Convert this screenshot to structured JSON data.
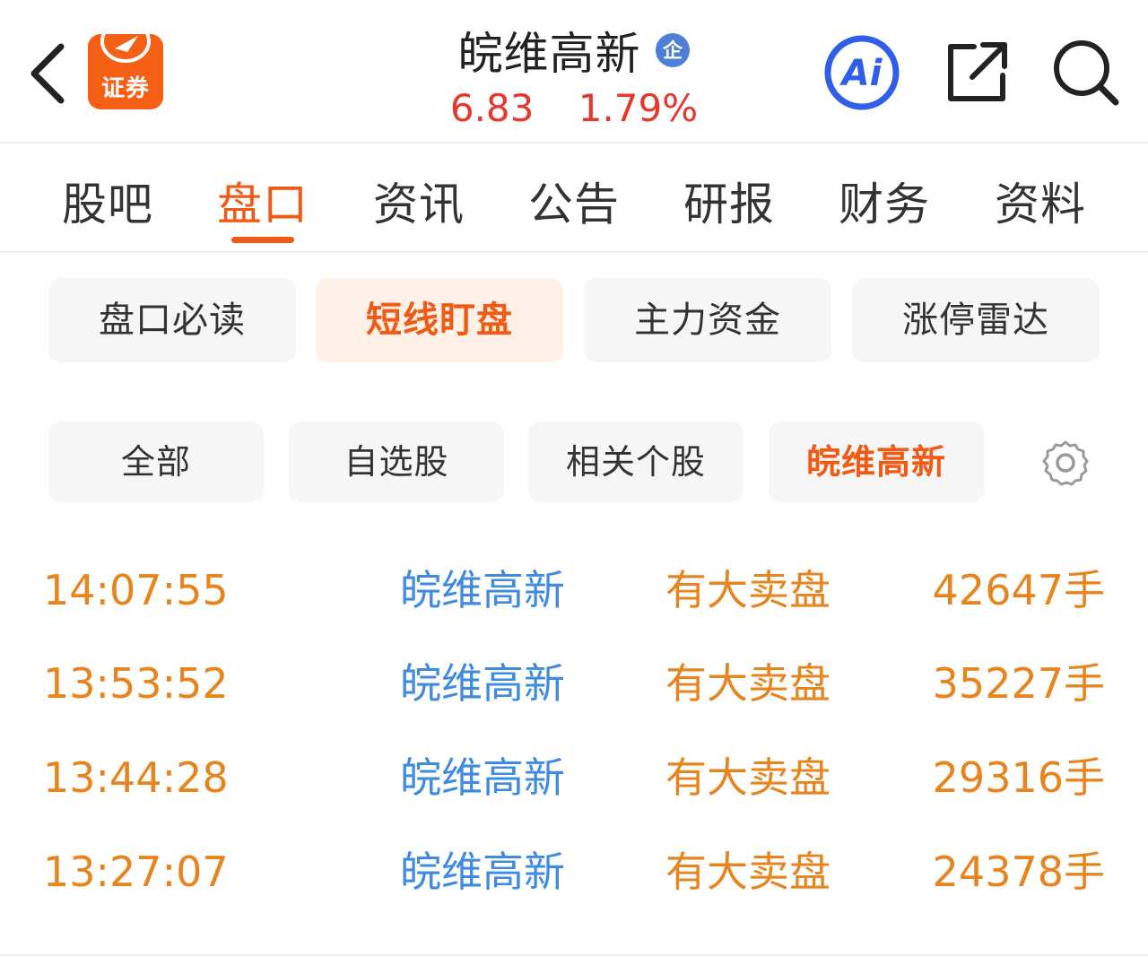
{
  "header": {
    "app_logo_text": "证券",
    "stock_name": "皖维高新",
    "badge_text": "企",
    "price": "6.83",
    "change_pct": "1.79%",
    "ai_label": "Ai"
  },
  "main_tabs": [
    {
      "label": "股吧",
      "active": false
    },
    {
      "label": "盘口",
      "active": true
    },
    {
      "label": "资讯",
      "active": false
    },
    {
      "label": "公告",
      "active": false
    },
    {
      "label": "研报",
      "active": false
    },
    {
      "label": "财务",
      "active": false
    },
    {
      "label": "资料",
      "active": false
    }
  ],
  "sub_tabs": [
    {
      "label": "盘口必读",
      "active": false
    },
    {
      "label": "短线盯盘",
      "active": true
    },
    {
      "label": "主力资金",
      "active": false
    },
    {
      "label": "涨停雷达",
      "active": false
    }
  ],
  "filters": [
    {
      "label": "全部",
      "active": false
    },
    {
      "label": "自选股",
      "active": false
    },
    {
      "label": "相关个股",
      "active": false
    },
    {
      "label": "皖维高新",
      "active": true
    }
  ],
  "alerts": [
    {
      "time": "14:07:55",
      "stock": "皖维高新",
      "event": "有大卖盘",
      "volume": "42647手"
    },
    {
      "time": "13:53:52",
      "stock": "皖维高新",
      "event": "有大卖盘",
      "volume": "35227手"
    },
    {
      "time": "13:44:28",
      "stock": "皖维高新",
      "event": "有大卖盘",
      "volume": "29316手"
    },
    {
      "time": "13:27:07",
      "stock": "皖维高新",
      "event": "有大卖盘",
      "volume": "24378手"
    }
  ],
  "colors": {
    "accent": "#f05a14",
    "price_up": "#e8362c",
    "alert_orange": "#e8841e",
    "stock_link_blue": "#3f8be0",
    "ai_blue": "#2f5ee8"
  },
  "icons": {
    "back": "chevron-left-icon",
    "ai": "ai-assistant-icon",
    "share": "share-external-icon",
    "search": "search-icon",
    "settings": "gear-icon"
  }
}
